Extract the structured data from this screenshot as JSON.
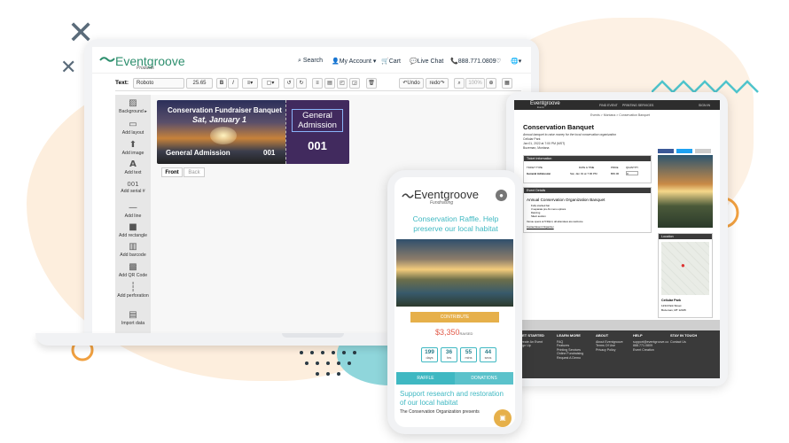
{
  "laptop": {
    "logo": "Eventgroove",
    "logo_sub": "Products",
    "nav": {
      "search": "Search",
      "account": "My Account ▾",
      "cart": "Cart",
      "live_chat": "Live Chat",
      "phone": "888.771.0809"
    },
    "toolbar": {
      "text_label": "Text:",
      "font": "Roboto",
      "size": "25.65",
      "undo": "Undo",
      "redo": "redo",
      "zoom": "100%"
    },
    "sidebar": [
      "Background ▸",
      "Add layout",
      "Add image",
      "Add text",
      "Add serial #",
      "Add line",
      "Add rectangle",
      "Add barcode",
      "Add QR Code",
      "Add perforation",
      "Import data"
    ],
    "ticket": {
      "title": "Conservation Fundraiser Banquet",
      "date": "Sat, January 1",
      "label": "General Admission",
      "number": "001",
      "stub_title": "General Admission",
      "stub_number": "001"
    },
    "tabs": {
      "front": "Front",
      "back": "Back"
    }
  },
  "tablet": {
    "logo": "Eventgroove",
    "logo_sub": "Events",
    "nav": {
      "find_event": "FIND EVENT",
      "printing": "PRINTING SERVICES",
      "sign_in": "SIGN IN"
    },
    "breadcrumb": "Events > Montana > Conservation Banquet",
    "title": "Conservation Banquet",
    "subtitle": "Annual banquet to raise money for the local conservation organization",
    "venue": "Cellular Park",
    "datetime": "Jan 01, 2022 at 7:00 PM (MST)",
    "location": "Bozeman, Montana",
    "ticket_info": {
      "header": "Ticket Information",
      "columns": [
        "TICKET TYPE",
        "DATE & TIME",
        "PRICE",
        "QUANTITY"
      ],
      "row": [
        "General Admission",
        "Sat, Jan 01 at 7:00 PM",
        "$50.00",
        "0"
      ]
    },
    "event_details": {
      "header": "Event Details",
      "title": "Annual Conservation Organization Banquet",
      "bullets": [
        "Fully stocked bar",
        "3 separate pre-fix menu options",
        "Dancing",
        "Silent auction"
      ],
      "footnote": "Venue opens at 5:30pm; all attendees are welcome",
      "contact": "Contact Event Organizer"
    },
    "location_box": {
      "header": "Location",
      "venue": "Cellular Park",
      "address": "1234 Park Street",
      "city": "Bozeman, MT 12345"
    },
    "footer": {
      "get_started": {
        "title": "GET STARTED",
        "items": [
          "Create An Event",
          "Sign Up"
        ]
      },
      "learn_more": {
        "title": "LEARN MORE",
        "items": [
          "FAQ",
          "Features",
          "Printing Services",
          "Online Fundraising",
          "Request A Demo"
        ]
      },
      "about": {
        "title": "ABOUT",
        "items": [
          "About Eventgroove",
          "Terms Of Use",
          "Privacy Policy"
        ]
      },
      "help": {
        "title": "HELP",
        "items": [
          "support@eventgroove.co",
          "888.771.0809",
          "Event Creation"
        ]
      },
      "stay_in_touch": {
        "title": "STAY IN TOUCH",
        "items": [
          "Contact Us"
        ]
      }
    }
  },
  "phone": {
    "logo": "Eventgroove",
    "logo_sub": "Fundraising",
    "headline": "Conservation Raffle. Help preserve our local habitat",
    "contribute": "CONTRIBUTE",
    "raised_amount": "$3,350",
    "raised_label": "RAISED",
    "countdown": [
      {
        "value": "199",
        "unit": "days"
      },
      {
        "value": "36",
        "unit": "hrs"
      },
      {
        "value": "55",
        "unit": "mins"
      },
      {
        "value": "44",
        "unit": "secs"
      }
    ],
    "tabs": {
      "raffle": "RAFFLE",
      "donations": "DONATIONS"
    },
    "support_title": "Support research and restoration of our local habitat",
    "support_text": "The Conservation Organization presents"
  },
  "colors": {
    "teal": "#3fb8c2",
    "brand_green": "#2e8f6e",
    "gold": "#e6b04a",
    "peach": "#fdf0e0"
  }
}
